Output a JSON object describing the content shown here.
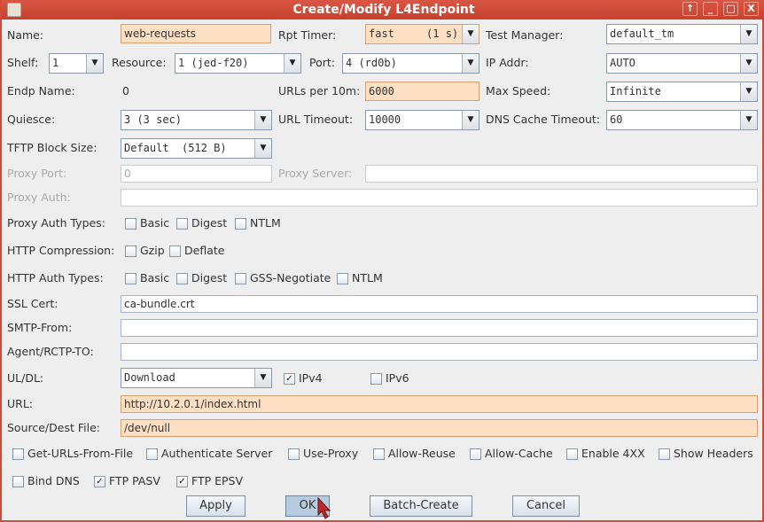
{
  "window": {
    "title": "Create/Modify L4Endpoint",
    "buttons": [
      "↑",
      "_",
      "□",
      "X"
    ]
  },
  "fields": {
    "name": {
      "label": "Name:",
      "value": "web-requests"
    },
    "rpt_timer": {
      "label": "Rpt Timer:",
      "value": "fast     (1 s)"
    },
    "test_manager": {
      "label": "Test Manager:",
      "value": "default_tm"
    },
    "shelf": {
      "label": "Shelf:",
      "value": "1"
    },
    "resource": {
      "label": "Resource:",
      "value": "1 (jed-f20)"
    },
    "port": {
      "label": "Port:",
      "value": "4 (rd0b)"
    },
    "ip_addr": {
      "label": "IP Addr:",
      "value": "AUTO"
    },
    "endp_name": {
      "label": "Endp Name:",
      "value": "0"
    },
    "urls_per_10m": {
      "label": "URLs per 10m:",
      "value": "6000"
    },
    "max_speed": {
      "label": "Max Speed:",
      "value": "Infinite"
    },
    "quiesce": {
      "label": "Quiesce:",
      "value": "3 (3 sec)"
    },
    "url_timeout": {
      "label": "URL Timeout:",
      "value": "10000"
    },
    "dns_cache_timeout": {
      "label": "DNS Cache Timeout:",
      "value": "60"
    },
    "tftp_block_size": {
      "label": "TFTP Block Size:",
      "value": "Default  (512 B)"
    },
    "proxy_port": {
      "label": "Proxy Port:",
      "value": "0"
    },
    "proxy_server": {
      "label": "Proxy Server:",
      "value": ""
    },
    "proxy_auth": {
      "label": "Proxy Auth:",
      "value": ""
    },
    "ssl_cert": {
      "label": "SSL Cert:",
      "value": "ca-bundle.crt"
    },
    "smtp_from": {
      "label": "SMTP-From:",
      "value": ""
    },
    "agent_rcpt_to": {
      "label": "Agent/RCTP-TO:",
      "value": ""
    },
    "ul_dl": {
      "label": "UL/DL:",
      "value": "Download"
    },
    "url": {
      "label": "URL:",
      "value": "http://10.2.0.1/index.html"
    },
    "source_dest_file": {
      "label": "Source/Dest File:",
      "value": "/dev/null"
    }
  },
  "proxy_auth_types": {
    "label": "Proxy Auth Types:",
    "options": [
      {
        "label": "Basic",
        "checked": false
      },
      {
        "label": "Digest",
        "checked": false
      },
      {
        "label": "NTLM",
        "checked": false
      }
    ]
  },
  "http_compression": {
    "label": "HTTP Compression:",
    "options": [
      {
        "label": "Gzip",
        "checked": false
      },
      {
        "label": "Deflate",
        "checked": false
      }
    ]
  },
  "http_auth_types": {
    "label": "HTTP Auth Types:",
    "options": [
      {
        "label": "Basic",
        "checked": false
      },
      {
        "label": "Digest",
        "checked": false
      },
      {
        "label": "GSS-Negotiate",
        "checked": false
      },
      {
        "label": "NTLM",
        "checked": false
      }
    ]
  },
  "ip_versions": [
    {
      "label": "IPv4",
      "checked": true
    },
    {
      "label": "IPv6",
      "checked": false
    }
  ],
  "flags_row1": [
    {
      "label": "Get-URLs-From-File",
      "checked": false
    },
    {
      "label": "Authenticate Server",
      "checked": false
    },
    {
      "label": "Use-Proxy",
      "checked": false
    },
    {
      "label": "Allow-Reuse",
      "checked": false
    },
    {
      "label": "Allow-Cache",
      "checked": false
    },
    {
      "label": "Enable 4XX",
      "checked": false
    },
    {
      "label": "Show Headers",
      "checked": false
    }
  ],
  "flags_row2": [
    {
      "label": "Bind DNS",
      "checked": false
    },
    {
      "label": "FTP PASV",
      "checked": true
    },
    {
      "label": "FTP EPSV",
      "checked": true
    }
  ],
  "actions": {
    "apply": "Apply",
    "ok": "OK",
    "batch_create": "Batch-Create",
    "cancel": "Cancel"
  },
  "colors": {
    "title_bar": "#d24a3a",
    "highlight_field": "#fde0c4"
  }
}
